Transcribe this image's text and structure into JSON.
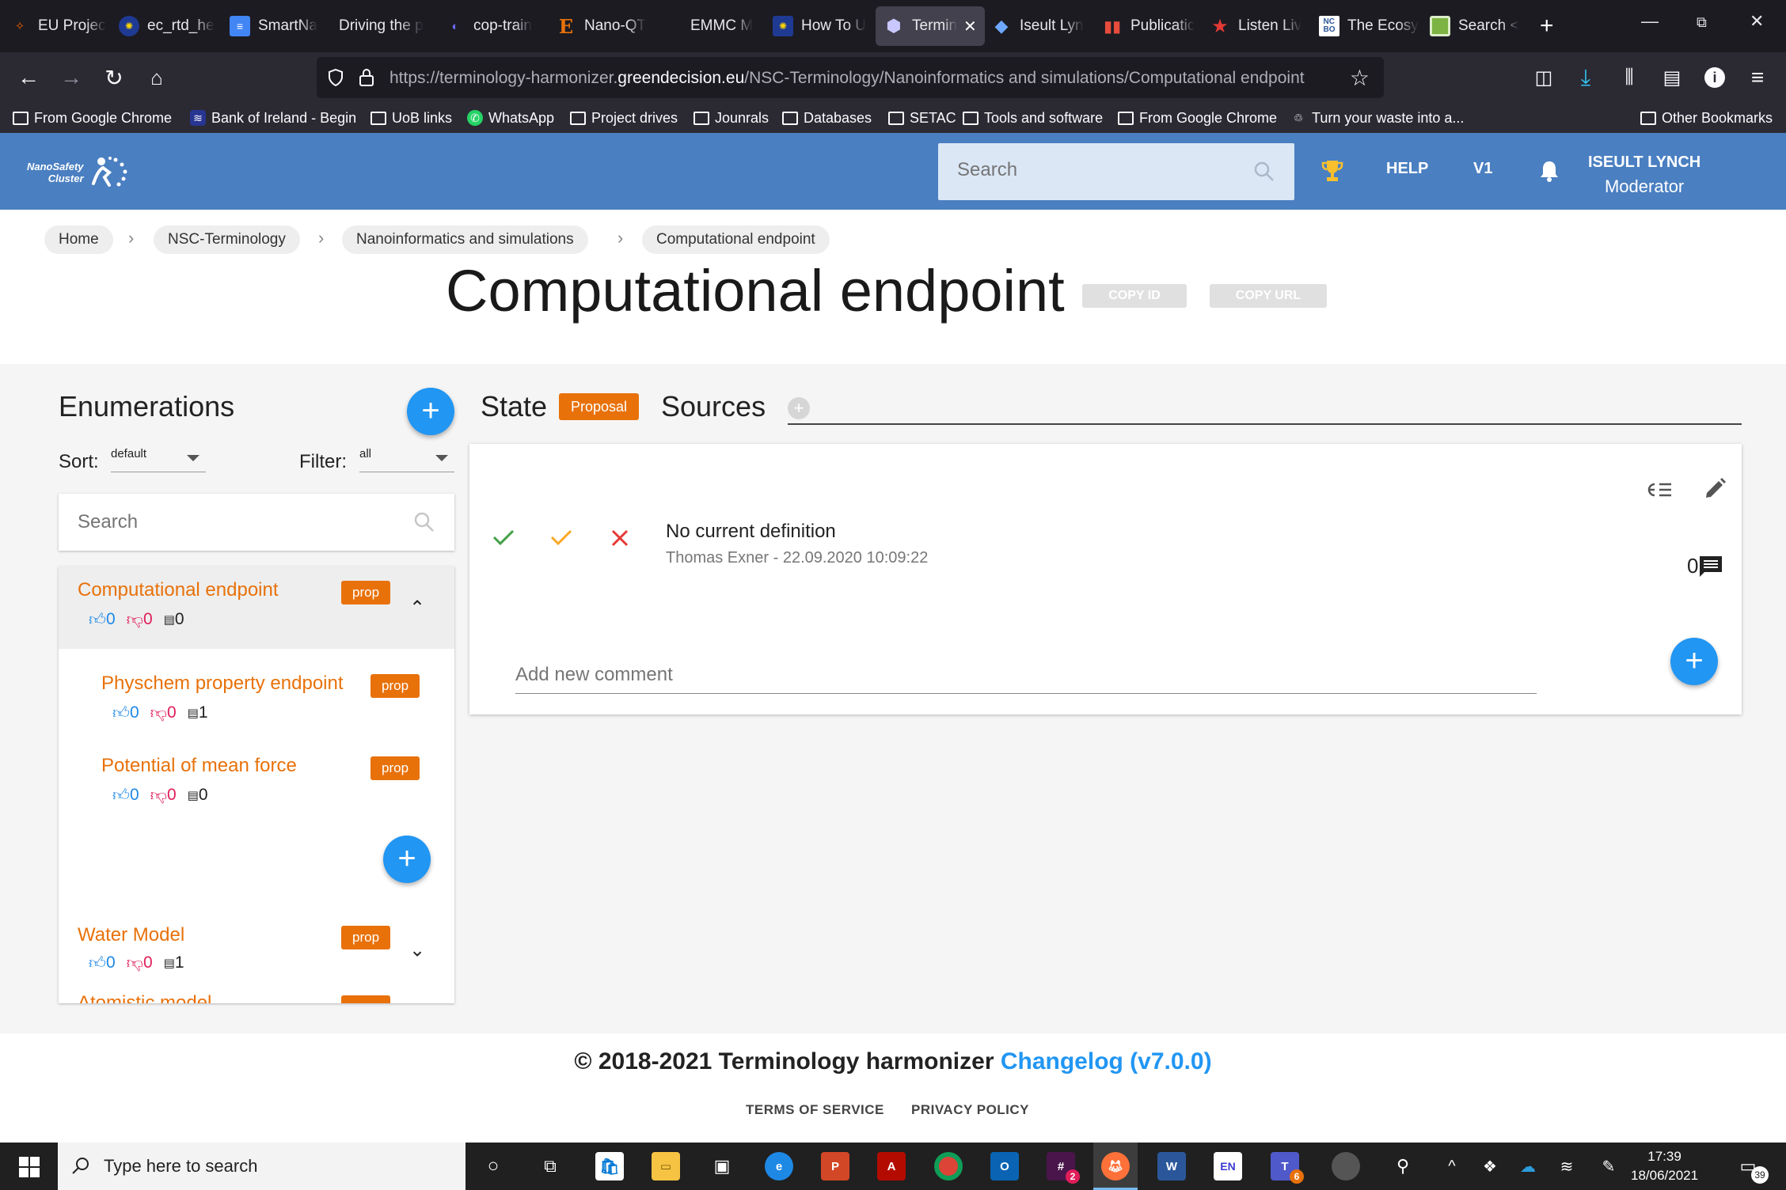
{
  "browser": {
    "tabs": [
      {
        "label": "EU Projec",
        "icon": "flame-icon",
        "color": "#e66000"
      },
      {
        "label": "ec_rtd_he",
        "icon": "eu-flag-icon",
        "color": "#1f3a93"
      },
      {
        "label": "SmartNa",
        "icon": "doc-icon",
        "color": "#4285f4"
      },
      {
        "label": "Driving the p",
        "icon": "none",
        "color": "#1c1b22"
      },
      {
        "label": "cop-train",
        "icon": "circle-icon",
        "color": "#3b3bd1"
      },
      {
        "label": "Nano-QT",
        "icon": "e-icon",
        "color": "#e8710a"
      },
      {
        "label": "EMMC M",
        "icon": "none",
        "color": "#1c1b22"
      },
      {
        "label": "How To U",
        "icon": "eu-flag-icon",
        "color": "#1f3a93"
      },
      {
        "label": "Termin",
        "icon": "hex-icon",
        "color": "#9aa0ff"
      },
      {
        "label": "Iseult Lyn",
        "icon": "diamond-icon",
        "color": "#6ea8fe"
      },
      {
        "label": "Publicatic",
        "icon": "bars-icon",
        "color": "#c0392b"
      },
      {
        "label": "Listen Liv",
        "icon": "star-icon",
        "color": "#e53935"
      },
      {
        "label": "The Ecosy",
        "icon": "ncbo-icon",
        "color": "#2b5797"
      },
      {
        "label": "Search <",
        "icon": "square-icon",
        "color": "#7cb342"
      }
    ],
    "url_prefix": "https://terminology-harmonizer.",
    "url_domain": "greendecision.eu",
    "url_suffix": "/NSC-Terminology/Nanoinformatics and simulations/Computational endpoint",
    "bookmarks": [
      {
        "label": "From Google Chrome",
        "icon": "folder-icon"
      },
      {
        "label": "Bank of Ireland - Begin",
        "icon": "boi-icon"
      },
      {
        "label": "UoB links",
        "icon": "folder-icon"
      },
      {
        "label": "WhatsApp",
        "icon": "whatsapp-icon"
      },
      {
        "label": "Project drives",
        "icon": "folder-icon"
      },
      {
        "label": "Jounrals",
        "icon": "folder-icon"
      },
      {
        "label": "Databases",
        "icon": "folder-icon"
      },
      {
        "label": "SETAC",
        "icon": "folder-icon"
      },
      {
        "label": "Tools and software",
        "icon": "folder-icon"
      },
      {
        "label": "From Google Chrome",
        "icon": "folder-icon"
      },
      {
        "label": "Turn your waste into a...",
        "icon": "recycle-icon"
      }
    ],
    "other_bookmarks": "Other Bookmarks"
  },
  "header": {
    "logo_line1": "NanoSafety",
    "logo_line2": "Cluster",
    "search_placeholder": "Search",
    "help": "HELP",
    "version": "V1",
    "user_name": "ISEULT LYNCH",
    "user_role": "Moderator"
  },
  "breadcrumb": [
    "Home",
    "NSC-Terminology",
    "Nanoinformatics and simulations",
    "Computational endpoint"
  ],
  "page": {
    "title": "Computational endpoint",
    "copy_id": "COPY ID",
    "copy_url": "COPY URL"
  },
  "enumerations": {
    "title": "Enumerations",
    "sort_label": "Sort:",
    "sort_value": "default",
    "filter_label": "Filter:",
    "filter_value": "all",
    "search_placeholder": "Search",
    "items": [
      {
        "name": "Computational endpoint",
        "badge": "prop",
        "up": "0",
        "down": "0",
        "comments": "0"
      },
      {
        "name": "Physchem property endpoint",
        "badge": "prop",
        "up": "0",
        "down": "0",
        "comments": "1"
      },
      {
        "name": "Potential of mean force",
        "badge": "prop",
        "up": "0",
        "down": "0",
        "comments": "0"
      },
      {
        "name": "Water Model",
        "badge": "prop",
        "up": "0",
        "down": "0",
        "comments": "1"
      },
      {
        "name": "Atomistic model",
        "badge": "prop"
      }
    ]
  },
  "detail": {
    "state_label": "State",
    "state_value": "Proposal",
    "sources_label": "Sources",
    "definition": "No current definition",
    "definition_meta": "Thomas Exner - 22.09.2020 10:09:22",
    "comment_count": "0",
    "comment_placeholder": "Add new comment"
  },
  "footer": {
    "copyright": "© 2018-2021 Terminology harmonizer",
    "changelog": "Changelog (v7.0.0)",
    "terms": "TERMS OF SERVICE",
    "privacy": "PRIVACY POLICY"
  },
  "taskbar": {
    "search_placeholder": "Type here to search",
    "time": "17:39",
    "date": "18/06/2021",
    "notifications": "39",
    "slack_badge": "2",
    "teams_badge": "6"
  },
  "colors": {
    "header_blue": "#4a7fc1",
    "accent_orange": "#e8710a",
    "fab_blue": "#2196f3",
    "upvote_blue": "#1e88e5",
    "downvote_red": "#e01e5a"
  }
}
